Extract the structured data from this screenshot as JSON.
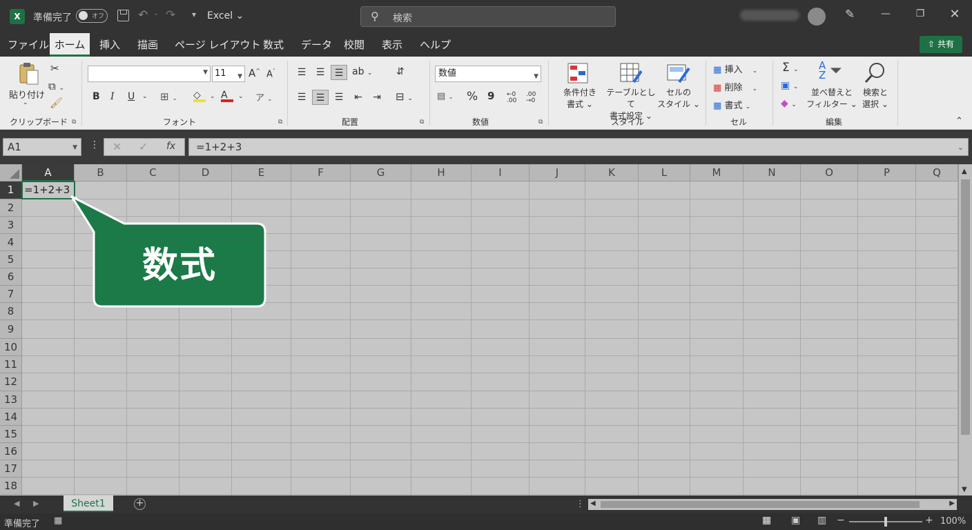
{
  "titlebar": {
    "logo": "X",
    "autosave_label": "準備完了",
    "autosave_state": "オフ",
    "title": "Excel",
    "search_placeholder": "検索",
    "undo_arrow": "⌄",
    "more": "⌄"
  },
  "menu": {
    "tabs": [
      "ファイル",
      "ホーム",
      "挿入",
      "描画",
      "ページ レイアウト",
      "数式",
      "データ",
      "校閲",
      "表示",
      "ヘルプ"
    ],
    "share": "共有"
  },
  "ribbon": {
    "clipboard": {
      "paste": "貼り付け",
      "label": "クリップボード"
    },
    "font": {
      "name": "",
      "size": "11",
      "label": "フォント",
      "bold": "B",
      "italic": "I",
      "underline": "U",
      "grow": "A^",
      "shrink": "Aˇ"
    },
    "alignment": {
      "label": "配置"
    },
    "number": {
      "format": "数値",
      "percent": "%",
      "comma": "9",
      "inc": ".00 .0",
      "label": "数値"
    },
    "styles": {
      "conditional": [
        "条件付き",
        "書式"
      ],
      "table": [
        "テーブルとして",
        "書式設定"
      ],
      "cell": [
        "セルの",
        "スタイル"
      ],
      "label": "スタイル"
    },
    "cells": {
      "insert": "挿入",
      "delete": "削除",
      "format": "書式",
      "label": "セル"
    },
    "editing": {
      "sum": "Σ",
      "sort": [
        "並べ替えと",
        "フィルター"
      ],
      "find": [
        "検索と",
        "選択"
      ],
      "label": "編集"
    }
  },
  "formula_bar": {
    "name_box": "A1",
    "fx": "fx",
    "formula": "=1+2+3"
  },
  "grid": {
    "columns": [
      "A",
      "B",
      "C",
      "D",
      "E",
      "F",
      "G",
      "H",
      "I",
      "J",
      "K",
      "L",
      "M",
      "N",
      "O",
      "P",
      "Q"
    ],
    "rows": [
      "1",
      "2",
      "3",
      "4",
      "5",
      "6",
      "7",
      "8",
      "9",
      "10",
      "11",
      "12",
      "13",
      "14",
      "15",
      "16",
      "17",
      "18"
    ],
    "a1_value": "=1+2+3",
    "callout": "数式",
    "accent": "#1e7145"
  },
  "sheets": {
    "tabs": [
      "Sheet1"
    ],
    "add": "+"
  },
  "status": {
    "text": "準備完了",
    "zoom": "100%"
  }
}
